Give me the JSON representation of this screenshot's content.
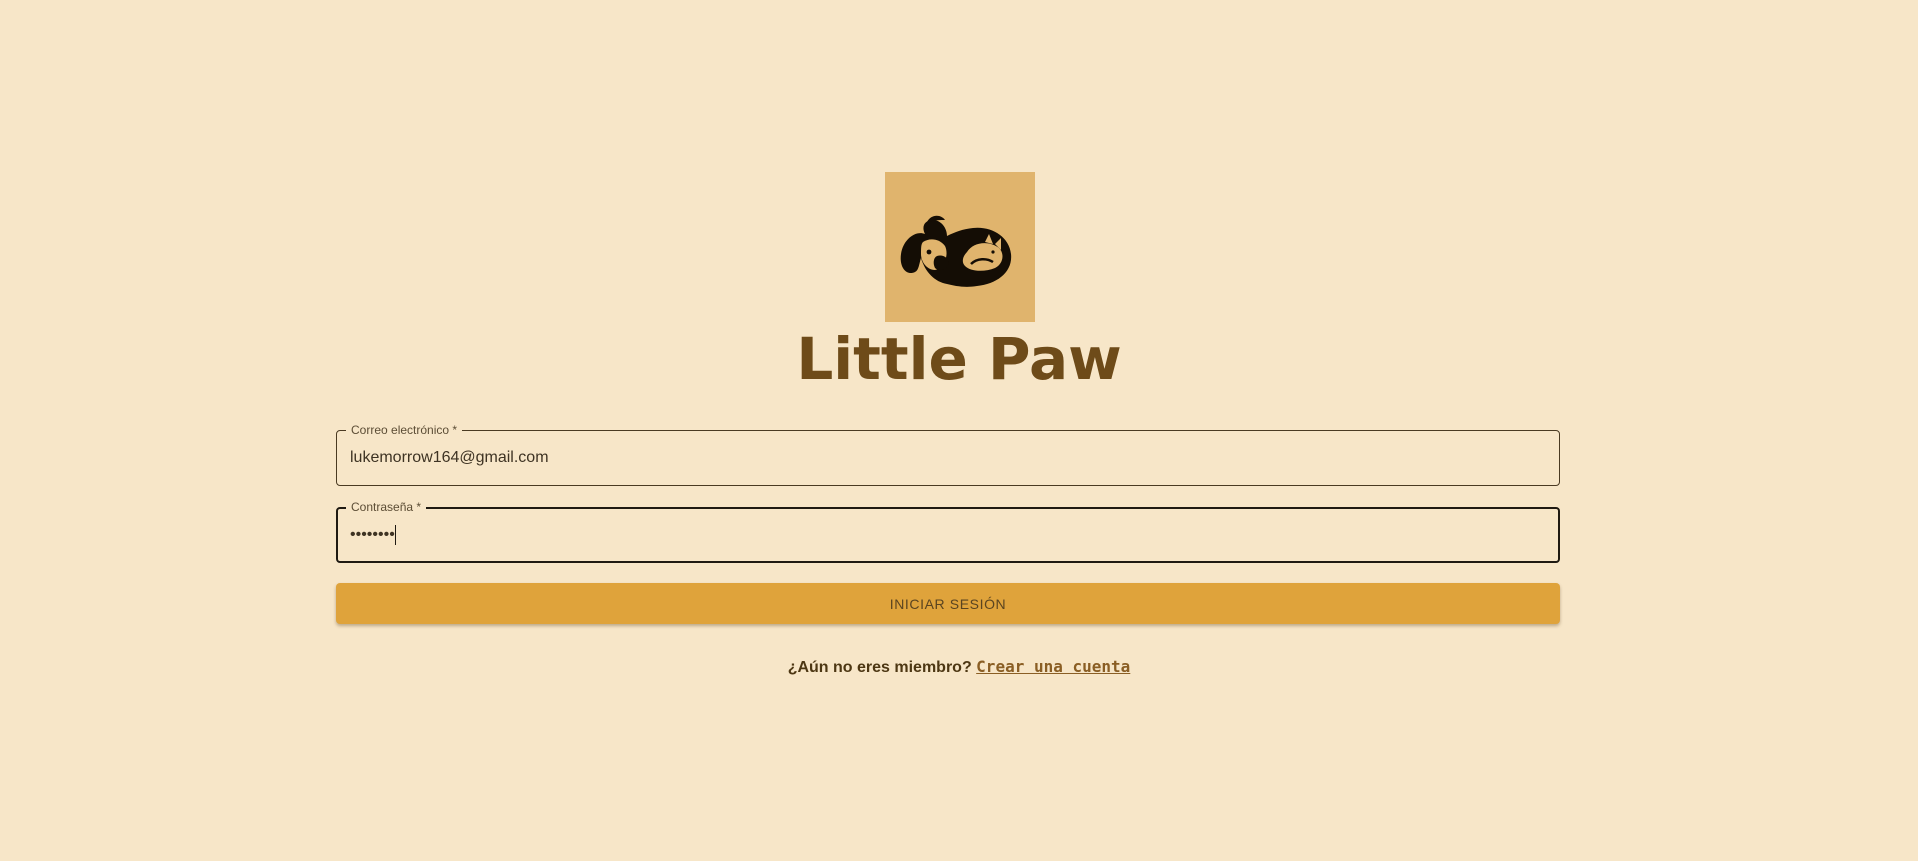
{
  "brand": {
    "title": "Little Paw",
    "logo_icon": "dog-and-cat-logo-icon",
    "logo_bg_color": "#e0b46d",
    "title_color": "#6e4b19"
  },
  "login_form": {
    "email": {
      "label": "Correo electrónico *",
      "value": "lukemorrow164@gmail.com"
    },
    "password": {
      "label": "Contraseña *",
      "value": "••••••••"
    },
    "submit_label": "INICIAR SESIÓN",
    "submit_color": "#dfa33b"
  },
  "signup": {
    "prompt": "¿Aún no eres miembro?",
    "link_label": "Crear una cuenta"
  },
  "colors": {
    "background": "#f7e6c8"
  }
}
